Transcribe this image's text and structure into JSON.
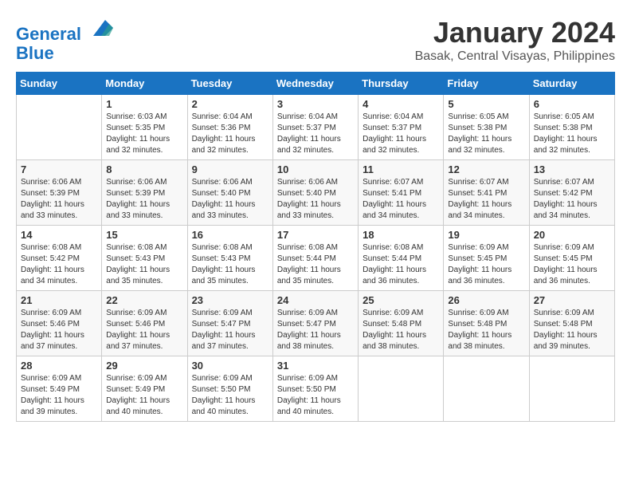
{
  "header": {
    "logo_line1": "General",
    "logo_line2": "Blue",
    "month_year": "January 2024",
    "location": "Basak, Central Visayas, Philippines"
  },
  "days_of_week": [
    "Sunday",
    "Monday",
    "Tuesday",
    "Wednesday",
    "Thursday",
    "Friday",
    "Saturday"
  ],
  "weeks": [
    [
      {
        "day": "",
        "info": ""
      },
      {
        "day": "1",
        "info": "Sunrise: 6:03 AM\nSunset: 5:35 PM\nDaylight: 11 hours\nand 32 minutes."
      },
      {
        "day": "2",
        "info": "Sunrise: 6:04 AM\nSunset: 5:36 PM\nDaylight: 11 hours\nand 32 minutes."
      },
      {
        "day": "3",
        "info": "Sunrise: 6:04 AM\nSunset: 5:37 PM\nDaylight: 11 hours\nand 32 minutes."
      },
      {
        "day": "4",
        "info": "Sunrise: 6:04 AM\nSunset: 5:37 PM\nDaylight: 11 hours\nand 32 minutes."
      },
      {
        "day": "5",
        "info": "Sunrise: 6:05 AM\nSunset: 5:38 PM\nDaylight: 11 hours\nand 32 minutes."
      },
      {
        "day": "6",
        "info": "Sunrise: 6:05 AM\nSunset: 5:38 PM\nDaylight: 11 hours\nand 32 minutes."
      }
    ],
    [
      {
        "day": "7",
        "info": "Sunrise: 6:06 AM\nSunset: 5:39 PM\nDaylight: 11 hours\nand 33 minutes."
      },
      {
        "day": "8",
        "info": "Sunrise: 6:06 AM\nSunset: 5:39 PM\nDaylight: 11 hours\nand 33 minutes."
      },
      {
        "day": "9",
        "info": "Sunrise: 6:06 AM\nSunset: 5:40 PM\nDaylight: 11 hours\nand 33 minutes."
      },
      {
        "day": "10",
        "info": "Sunrise: 6:06 AM\nSunset: 5:40 PM\nDaylight: 11 hours\nand 33 minutes."
      },
      {
        "day": "11",
        "info": "Sunrise: 6:07 AM\nSunset: 5:41 PM\nDaylight: 11 hours\nand 34 minutes."
      },
      {
        "day": "12",
        "info": "Sunrise: 6:07 AM\nSunset: 5:41 PM\nDaylight: 11 hours\nand 34 minutes."
      },
      {
        "day": "13",
        "info": "Sunrise: 6:07 AM\nSunset: 5:42 PM\nDaylight: 11 hours\nand 34 minutes."
      }
    ],
    [
      {
        "day": "14",
        "info": "Sunrise: 6:08 AM\nSunset: 5:42 PM\nDaylight: 11 hours\nand 34 minutes."
      },
      {
        "day": "15",
        "info": "Sunrise: 6:08 AM\nSunset: 5:43 PM\nDaylight: 11 hours\nand 35 minutes."
      },
      {
        "day": "16",
        "info": "Sunrise: 6:08 AM\nSunset: 5:43 PM\nDaylight: 11 hours\nand 35 minutes."
      },
      {
        "day": "17",
        "info": "Sunrise: 6:08 AM\nSunset: 5:44 PM\nDaylight: 11 hours\nand 35 minutes."
      },
      {
        "day": "18",
        "info": "Sunrise: 6:08 AM\nSunset: 5:44 PM\nDaylight: 11 hours\nand 36 minutes."
      },
      {
        "day": "19",
        "info": "Sunrise: 6:09 AM\nSunset: 5:45 PM\nDaylight: 11 hours\nand 36 minutes."
      },
      {
        "day": "20",
        "info": "Sunrise: 6:09 AM\nSunset: 5:45 PM\nDaylight: 11 hours\nand 36 minutes."
      }
    ],
    [
      {
        "day": "21",
        "info": "Sunrise: 6:09 AM\nSunset: 5:46 PM\nDaylight: 11 hours\nand 37 minutes."
      },
      {
        "day": "22",
        "info": "Sunrise: 6:09 AM\nSunset: 5:46 PM\nDaylight: 11 hours\nand 37 minutes."
      },
      {
        "day": "23",
        "info": "Sunrise: 6:09 AM\nSunset: 5:47 PM\nDaylight: 11 hours\nand 37 minutes."
      },
      {
        "day": "24",
        "info": "Sunrise: 6:09 AM\nSunset: 5:47 PM\nDaylight: 11 hours\nand 38 minutes."
      },
      {
        "day": "25",
        "info": "Sunrise: 6:09 AM\nSunset: 5:48 PM\nDaylight: 11 hours\nand 38 minutes."
      },
      {
        "day": "26",
        "info": "Sunrise: 6:09 AM\nSunset: 5:48 PM\nDaylight: 11 hours\nand 38 minutes."
      },
      {
        "day": "27",
        "info": "Sunrise: 6:09 AM\nSunset: 5:48 PM\nDaylight: 11 hours\nand 39 minutes."
      }
    ],
    [
      {
        "day": "28",
        "info": "Sunrise: 6:09 AM\nSunset: 5:49 PM\nDaylight: 11 hours\nand 39 minutes."
      },
      {
        "day": "29",
        "info": "Sunrise: 6:09 AM\nSunset: 5:49 PM\nDaylight: 11 hours\nand 40 minutes."
      },
      {
        "day": "30",
        "info": "Sunrise: 6:09 AM\nSunset: 5:50 PM\nDaylight: 11 hours\nand 40 minutes."
      },
      {
        "day": "31",
        "info": "Sunrise: 6:09 AM\nSunset: 5:50 PM\nDaylight: 11 hours\nand 40 minutes."
      },
      {
        "day": "",
        "info": ""
      },
      {
        "day": "",
        "info": ""
      },
      {
        "day": "",
        "info": ""
      }
    ]
  ]
}
